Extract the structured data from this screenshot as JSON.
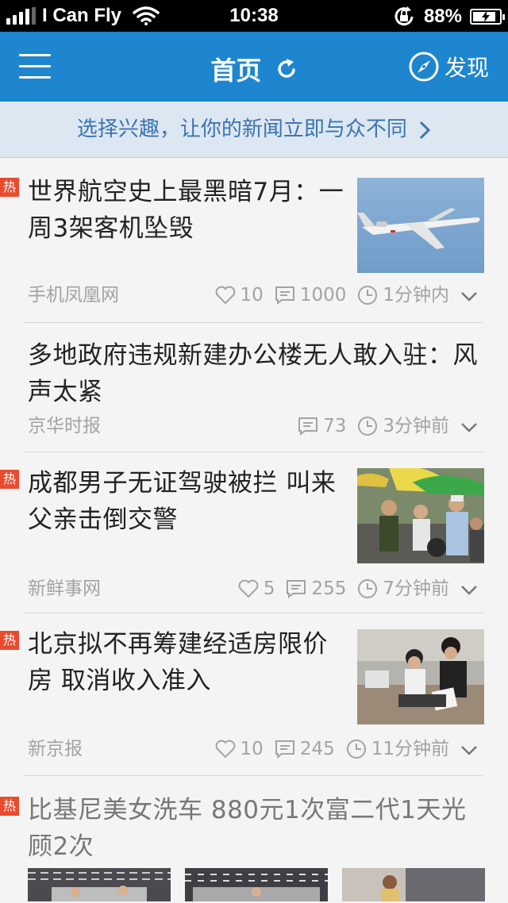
{
  "status_bar": {
    "carrier": "I Can Fly",
    "time": "10:38",
    "battery_text": "88%",
    "battery_level": 0.88
  },
  "navbar": {
    "title": "首页",
    "discover_label": "发现",
    "accent_color": "#1e85cf"
  },
  "interest_bar": {
    "text": "选择兴趣，让你的新闻立即与众不同"
  },
  "hot_label": "热",
  "feed": [
    {
      "title_line1": "世界航空史上最黑暗7月：一",
      "title_line2": "周3架客机坠毁",
      "source": "手机凤凰网",
      "likes": "10",
      "comments": "1000",
      "time": "1分钟内",
      "hot": true,
      "image": "airplane-photo"
    },
    {
      "title_line1": "多地政府违规新建办公楼无人敢入驻：风",
      "title_line2": "声太紧",
      "source": "京华时报",
      "comments": "73",
      "time": "3分钟前",
      "hot": false
    },
    {
      "title_line1": "成都男子无证驾驶被拦 叫来",
      "title_line2": "父亲击倒交警",
      "source": "新鲜事网",
      "likes": "5",
      "comments": "255",
      "time": "7分钟前",
      "hot": true,
      "image": "street-crowd-photo"
    },
    {
      "title_line1": "北京拟不再筹建经适房限价",
      "title_line2": "房 取消收入准入",
      "source": "新京报",
      "likes": "10",
      "comments": "245",
      "time": "11分钟前",
      "hot": true,
      "image": "people-sitting-photo"
    },
    {
      "title_line1": "比基尼美女洗车 880元1次富二代1天光",
      "title_line2": "顾2次",
      "hot": true,
      "images": [
        "car-wash-photo-1",
        "car-wash-photo-2",
        "car-wash-photo-3"
      ]
    }
  ]
}
